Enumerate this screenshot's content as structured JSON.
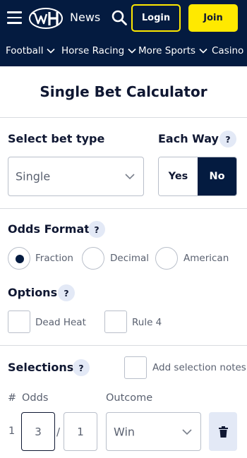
{
  "header": {
    "news_label": "News",
    "login_label": "Login",
    "join_label": "Join",
    "icons": [
      "hamburger-menu-icon",
      "william-hill-logo",
      "search-icon"
    ],
    "colors": {
      "navy": "#041b40",
      "yellow": "#ffe900"
    }
  },
  "nav": {
    "items": [
      {
        "label": "Football"
      },
      {
        "label": "Horse Racing"
      },
      {
        "label": "More Sports"
      },
      {
        "label": "Casino"
      }
    ]
  },
  "calculator": {
    "title": "Single Bet Calculator",
    "bet_type": {
      "label": "Select bet type",
      "value": "Single"
    },
    "each_way": {
      "label": "Each Way",
      "help": "?",
      "yes": "Yes",
      "no": "No",
      "selected": "No"
    },
    "odds_format": {
      "label": "Odds Format",
      "help": "?",
      "options": [
        "Fraction",
        "Decimal",
        "American"
      ],
      "selected": "Fraction"
    },
    "options": {
      "label": "Options",
      "help": "?",
      "items": [
        "Dead Heat",
        "Rule 4"
      ]
    },
    "selections": {
      "label": "Selections",
      "help": "?",
      "notes_label": "Add selection notes",
      "col_num": "#",
      "col_odds": "Odds",
      "col_outcome": "Outcome",
      "rows": [
        {
          "num": "1",
          "odds_num": "3",
          "separator": "/",
          "odds_den": "1",
          "outcome": "Win"
        }
      ]
    }
  }
}
